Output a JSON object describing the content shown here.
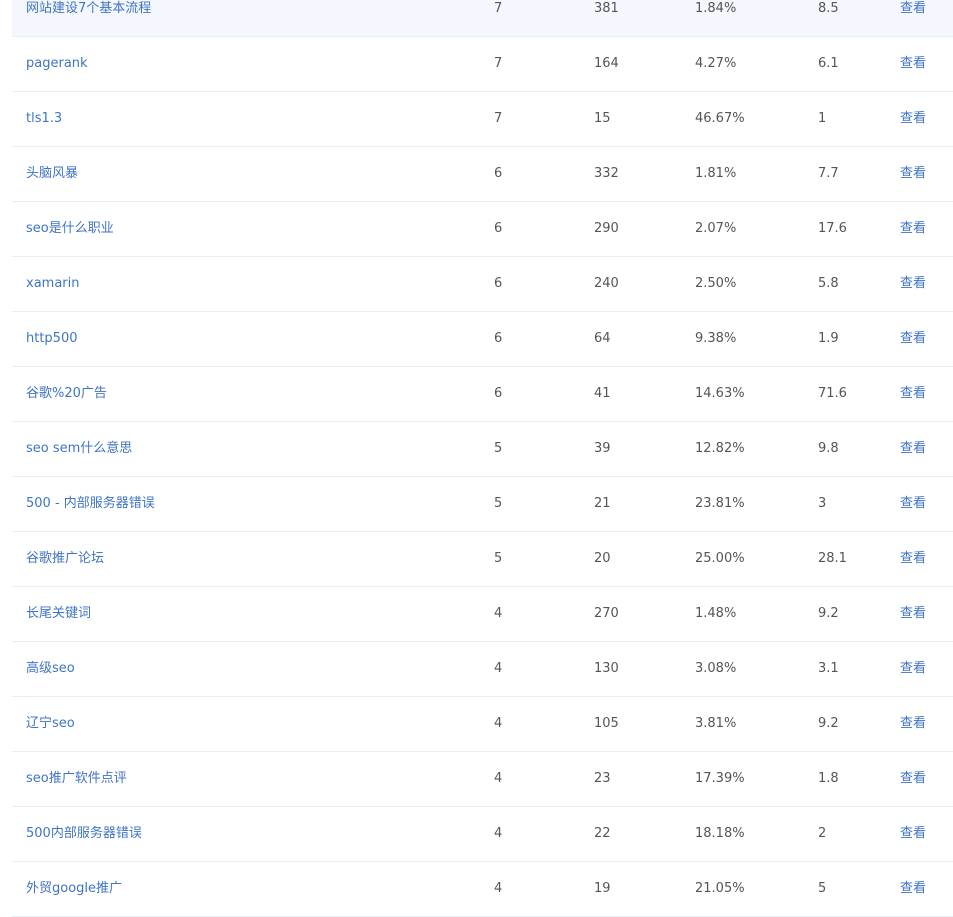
{
  "action_label": "查看",
  "rows": [
    {
      "keyword": "网站建设7个基本流程",
      "v1": "7",
      "v2": "381",
      "v3": "1.84%",
      "v4": "8.5"
    },
    {
      "keyword": "pagerank",
      "v1": "7",
      "v2": "164",
      "v3": "4.27%",
      "v4": "6.1"
    },
    {
      "keyword": "tls1.3",
      "v1": "7",
      "v2": "15",
      "v3": "46.67%",
      "v4": "1"
    },
    {
      "keyword": "头脑风暴",
      "v1": "6",
      "v2": "332",
      "v3": "1.81%",
      "v4": "7.7"
    },
    {
      "keyword": "seo是什么职业",
      "v1": "6",
      "v2": "290",
      "v3": "2.07%",
      "v4": "17.6"
    },
    {
      "keyword": "xamarin",
      "v1": "6",
      "v2": "240",
      "v3": "2.50%",
      "v4": "5.8"
    },
    {
      "keyword": "http500",
      "v1": "6",
      "v2": "64",
      "v3": "9.38%",
      "v4": "1.9"
    },
    {
      "keyword": "谷歌%20广告",
      "v1": "6",
      "v2": "41",
      "v3": "14.63%",
      "v4": "71.6"
    },
    {
      "keyword": "seo sem什么意思",
      "v1": "5",
      "v2": "39",
      "v3": "12.82%",
      "v4": "9.8"
    },
    {
      "keyword": "500 - 内部服务器错误",
      "v1": "5",
      "v2": "21",
      "v3": "23.81%",
      "v4": "3"
    },
    {
      "keyword": "谷歌推广论坛",
      "v1": "5",
      "v2": "20",
      "v3": "25.00%",
      "v4": "28.1"
    },
    {
      "keyword": "长尾关键词",
      "v1": "4",
      "v2": "270",
      "v3": "1.48%",
      "v4": "9.2"
    },
    {
      "keyword": "高级seo",
      "v1": "4",
      "v2": "130",
      "v3": "3.08%",
      "v4": "3.1"
    },
    {
      "keyword": "辽宁seo",
      "v1": "4",
      "v2": "105",
      "v3": "3.81%",
      "v4": "9.2"
    },
    {
      "keyword": "seo推广软件点评",
      "v1": "4",
      "v2": "23",
      "v3": "17.39%",
      "v4": "1.8"
    },
    {
      "keyword": "500内部服务器错误",
      "v1": "4",
      "v2": "22",
      "v3": "18.18%",
      "v4": "2"
    },
    {
      "keyword": "外贸google推广",
      "v1": "4",
      "v2": "19",
      "v3": "21.05%",
      "v4": "5"
    }
  ]
}
